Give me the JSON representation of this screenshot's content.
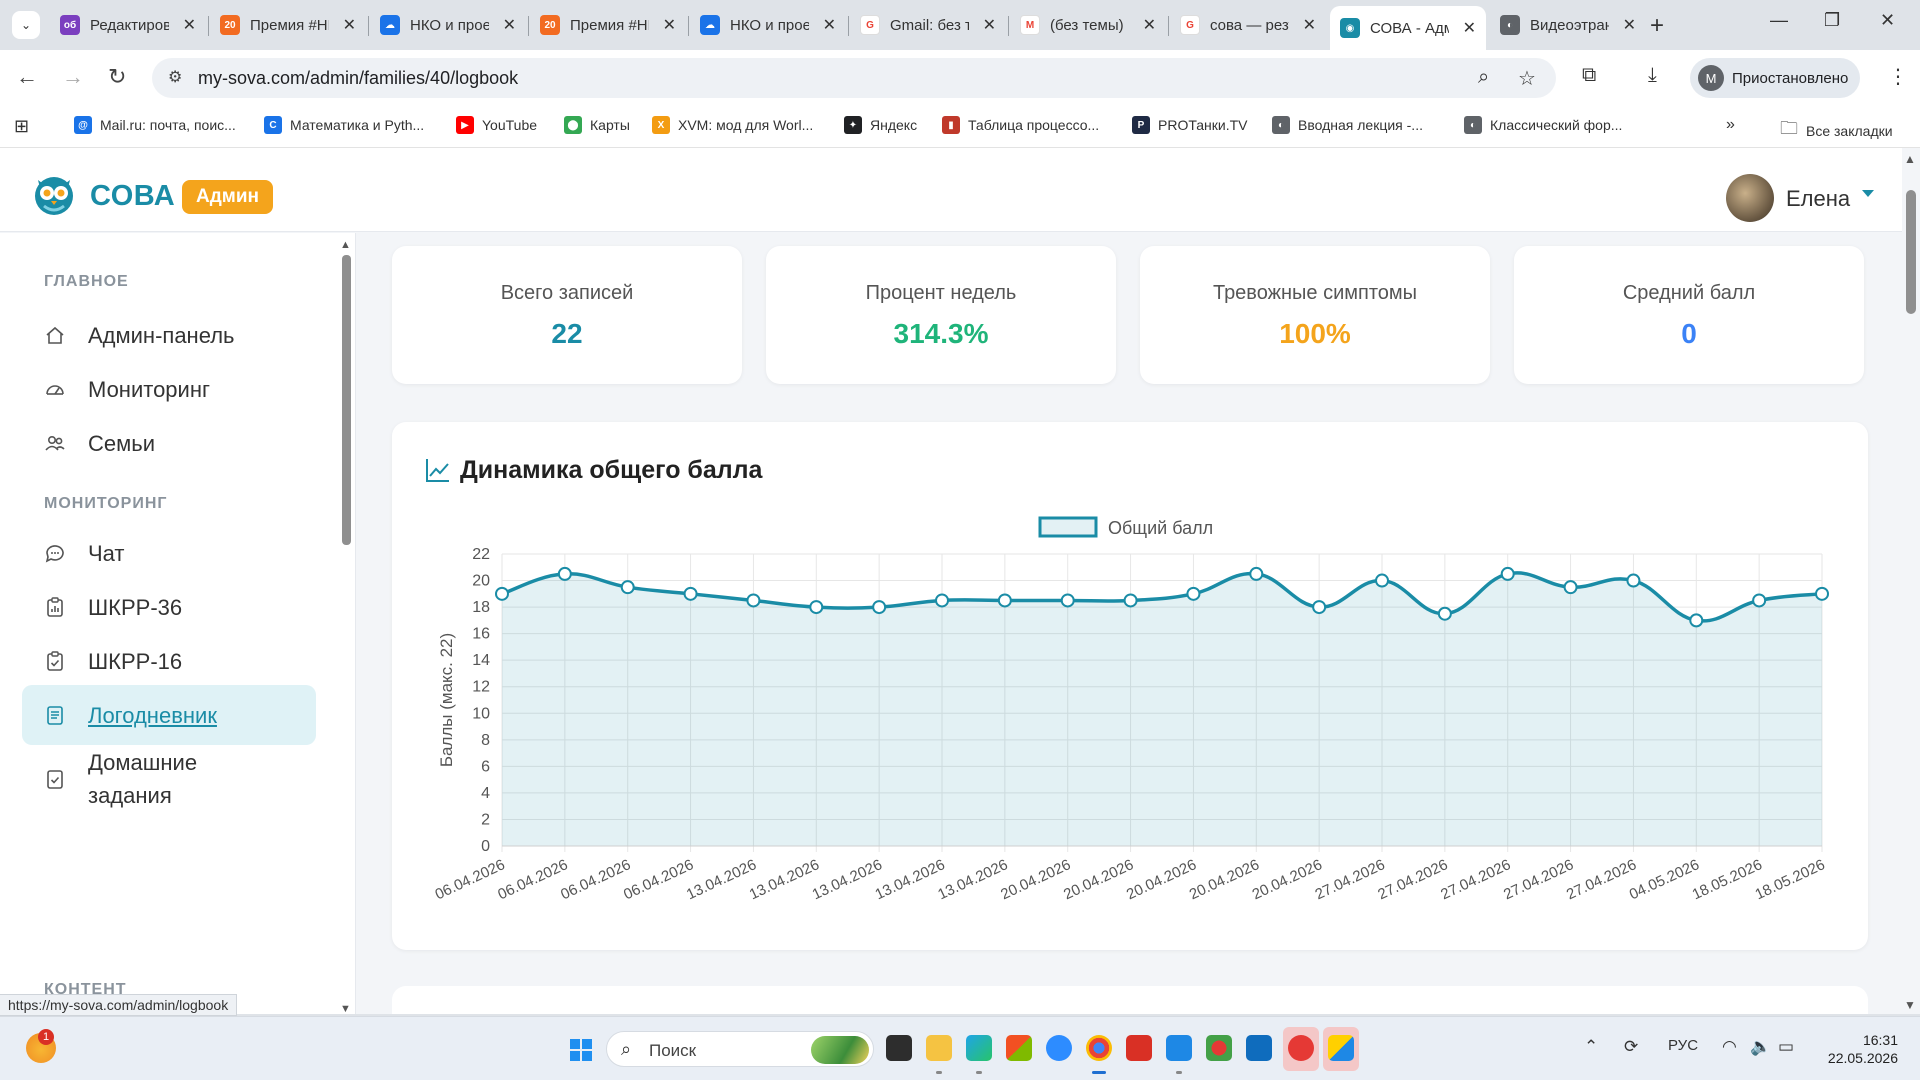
{
  "browser": {
    "tabs": [
      {
        "title": "Редактирование",
        "icon_color": "#7b3fbf",
        "icon_char": "об"
      },
      {
        "title": "Премия #НКО",
        "icon_color": "#f26b21",
        "icon_char": "20"
      },
      {
        "title": "НКО и проекты",
        "icon_color": "#1a73e8",
        "icon_char": "☁"
      },
      {
        "title": "Премия #НКО",
        "icon_color": "#f26b21",
        "icon_char": "20"
      },
      {
        "title": "НКО и проекты",
        "icon_color": "#1a73e8",
        "icon_char": "☁"
      },
      {
        "title": "Gmail: без темы",
        "icon_color": "#ffffff",
        "icon_char": "G"
      },
      {
        "title": "(без темы)",
        "icon_color": "#ffffff",
        "icon_char": "M"
      },
      {
        "title": "сова — результаты",
        "icon_color": "#ffffff",
        "icon_char": "G"
      },
      {
        "title": "СОВА - Админ",
        "icon_color": "#1a8ca6",
        "icon_char": "◉"
      },
      {
        "title": "Видеоэтрансляция",
        "icon_color": "#5f6368",
        "icon_char": "◐"
      }
    ],
    "active_tab_index": 8,
    "new_tab_label": "+",
    "url": "my-sova.com/admin/families/40/logbook",
    "profile_initial": "M",
    "profile_status": "Приостановлено",
    "bookmarks": [
      {
        "label": "Mail.ru: почта, поис...",
        "icon_color": "#1a73e8",
        "icon_char": "@"
      },
      {
        "label": "Математика и Pyth...",
        "icon_color": "#1a73e8",
        "icon_char": "C"
      },
      {
        "label": "YouTube",
        "icon_color": "#ff0000",
        "icon_char": "▶"
      },
      {
        "label": "Карты",
        "icon_color": "#34a853",
        "icon_char": "⬤"
      },
      {
        "label": "XVM: мод для Worl...",
        "icon_color": "#f39c12",
        "icon_char": "X"
      },
      {
        "label": "Яндекс",
        "icon_color": "#202124",
        "icon_char": "✦"
      },
      {
        "label": "Таблица процессо...",
        "icon_color": "#c0392b",
        "icon_char": "▮"
      },
      {
        "label": "PROТанки.TV",
        "icon_color": "#1f2a44",
        "icon_char": "P"
      },
      {
        "label": "Вводная лекция -...",
        "icon_color": "#5f6368",
        "icon_char": "◐"
      },
      {
        "label": "Классический фор...",
        "icon_color": "#5f6368",
        "icon_char": "◐"
      }
    ],
    "all_bookmarks": "Все закладки",
    "status_url": "https://my-sova.com/admin/logbook"
  },
  "app": {
    "logo_text": "СОВА",
    "badge": "Админ",
    "user_name": "Елена",
    "brand_color": "#1a8ca6",
    "accent_color": "#f4a41c"
  },
  "sidebar": {
    "section_main": "ГЛАВНОЕ",
    "section_monitoring": "МОНИТОРИНГ",
    "section_content": "КОНТЕНТ",
    "items": [
      {
        "label": "Админ-панель",
        "icon": "home-icon"
      },
      {
        "label": "Мониторинг",
        "icon": "gauge-icon"
      },
      {
        "label": "Семьи",
        "icon": "users-icon"
      },
      {
        "label": "Чат",
        "icon": "chat-icon"
      },
      {
        "label": "ШКРР-36",
        "icon": "clipboard-chart-icon"
      },
      {
        "label": "ШКРР-16",
        "icon": "clipboard-check-icon"
      },
      {
        "label": "Логодневник",
        "icon": "journal-icon",
        "active": true
      },
      {
        "label": "Домашние задания",
        "icon": "task-icon"
      }
    ]
  },
  "stats": [
    {
      "label": "Всего записей",
      "value": "22",
      "color": "#1a8ca6"
    },
    {
      "label": "Процент недель",
      "value": "314.3%",
      "color": "#1fb47a"
    },
    {
      "label": "Тревожные симптомы",
      "value": "100%",
      "color": "#f4a41c"
    },
    {
      "label": "Средний балл",
      "value": "0",
      "color": "#3b82f6"
    }
  ],
  "chart_card": {
    "title": "Динамика общего балла"
  },
  "chart_data": {
    "type": "line",
    "title": "",
    "xlabel": "",
    "ylabel": "Баллы (макс. 22)",
    "ylim": [
      0,
      22
    ],
    "yticks": [
      0,
      2,
      4,
      6,
      8,
      10,
      12,
      14,
      16,
      18,
      20,
      22
    ],
    "legend_position": "top-center",
    "grid": true,
    "fill": true,
    "color": "#1a8ca6",
    "categories": [
      "06.04.2026",
      "06.04.2026",
      "06.04.2026",
      "06.04.2026",
      "13.04.2026",
      "13.04.2026",
      "13.04.2026",
      "13.04.2026",
      "13.04.2026",
      "20.04.2026",
      "20.04.2026",
      "20.04.2026",
      "20.04.2026",
      "20.04.2026",
      "27.04.2026",
      "27.04.2026",
      "27.04.2026",
      "27.04.2026",
      "27.04.2026",
      "04.05.2026",
      "18.05.2026",
      "18.05.2026"
    ],
    "series": [
      {
        "name": "Общий балл",
        "values": [
          19,
          20.5,
          19.5,
          19,
          18.5,
          18,
          18,
          18.5,
          18.5,
          18.5,
          18.5,
          19,
          20.5,
          18,
          20,
          17.5,
          20.5,
          19.5,
          20,
          17,
          18.5,
          19
        ]
      }
    ]
  },
  "taskbar": {
    "weather_badge": "1",
    "search_placeholder": "Поиск",
    "lang": "РУС",
    "time": "16:31",
    "date": "22.05.2026"
  }
}
